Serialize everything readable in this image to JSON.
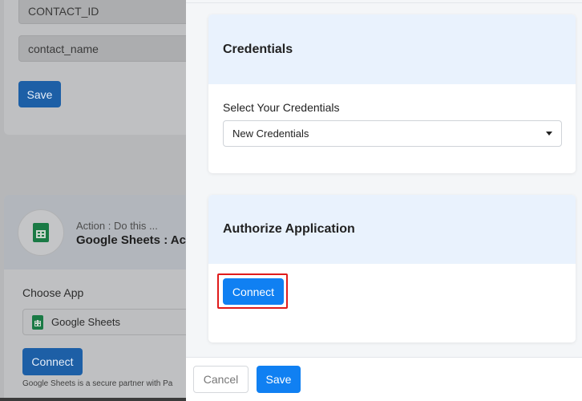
{
  "background": {
    "fields": {
      "contact_id": "CONTACT_ID",
      "contact_name": "contact_name"
    },
    "save_label": "Save",
    "action": {
      "subtitle": "Action : Do this ...",
      "title": "Google Sheets : Ac",
      "app_icon": "google-sheets-icon"
    },
    "choose_app_label": "Choose App",
    "selected_app": "Google Sheets",
    "connect_label": "Connect",
    "note": "Google Sheets is a secure partner with Pa"
  },
  "panel": {
    "credentials": {
      "heading": "Credentials",
      "field_label": "Select Your Credentials",
      "selected": "New Credentials"
    },
    "authorize": {
      "heading": "Authorize Application",
      "connect_label": "Connect"
    },
    "footer": {
      "cancel_label": "Cancel",
      "save_label": "Save"
    }
  },
  "colors": {
    "primary": "#1080f2",
    "highlight": "#e01b1b",
    "card_header": "#e9f2fd"
  }
}
